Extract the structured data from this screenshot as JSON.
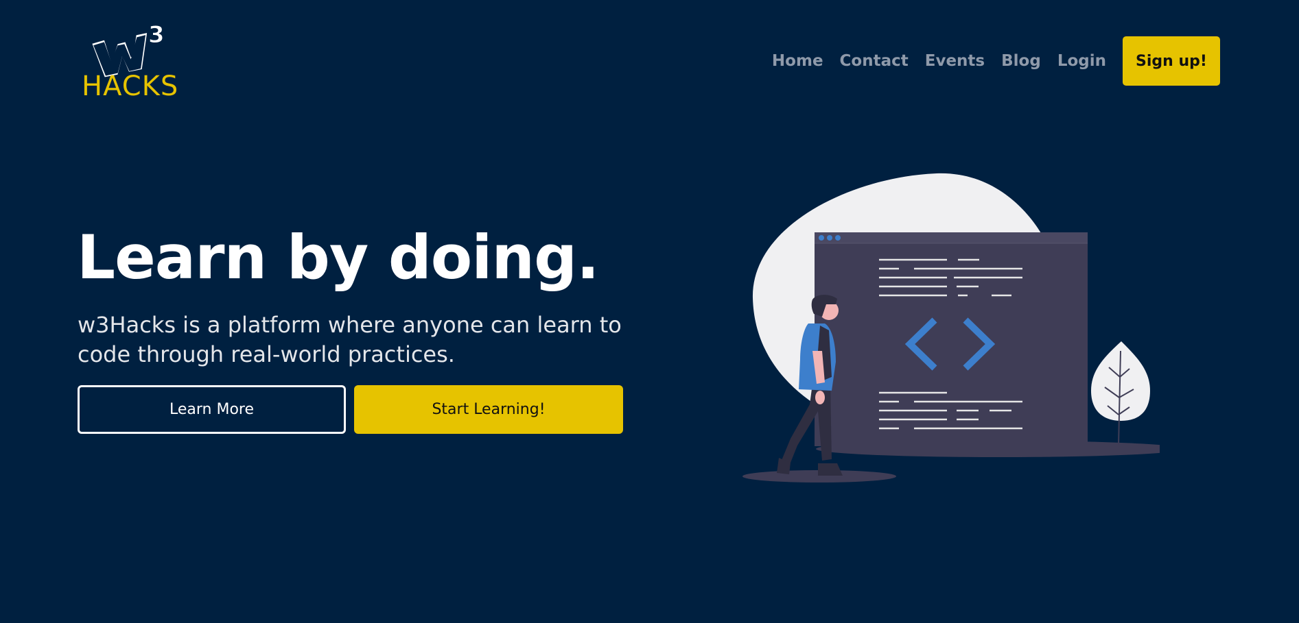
{
  "brand": {
    "logo_letter": "W",
    "logo_superscript": "3",
    "logo_word": "HACKS"
  },
  "nav": {
    "links": [
      {
        "label": "Home"
      },
      {
        "label": "Contact"
      },
      {
        "label": "Events"
      },
      {
        "label": "Blog"
      },
      {
        "label": "Login"
      }
    ],
    "signup_label": "Sign up!"
  },
  "hero": {
    "title": "Learn by doing.",
    "subtitle": "w3Hacks is a platform where anyone can learn to code through real-world practices.",
    "learn_more_label": "Learn More",
    "start_learning_label": "Start Learning!"
  },
  "colors": {
    "background": "#002040",
    "accent": "#e6c300",
    "nav_text": "#8f9aaa",
    "illustration_blue": "#3d7fcc"
  },
  "illustration": {
    "code_icon": "code-brackets-icon"
  }
}
